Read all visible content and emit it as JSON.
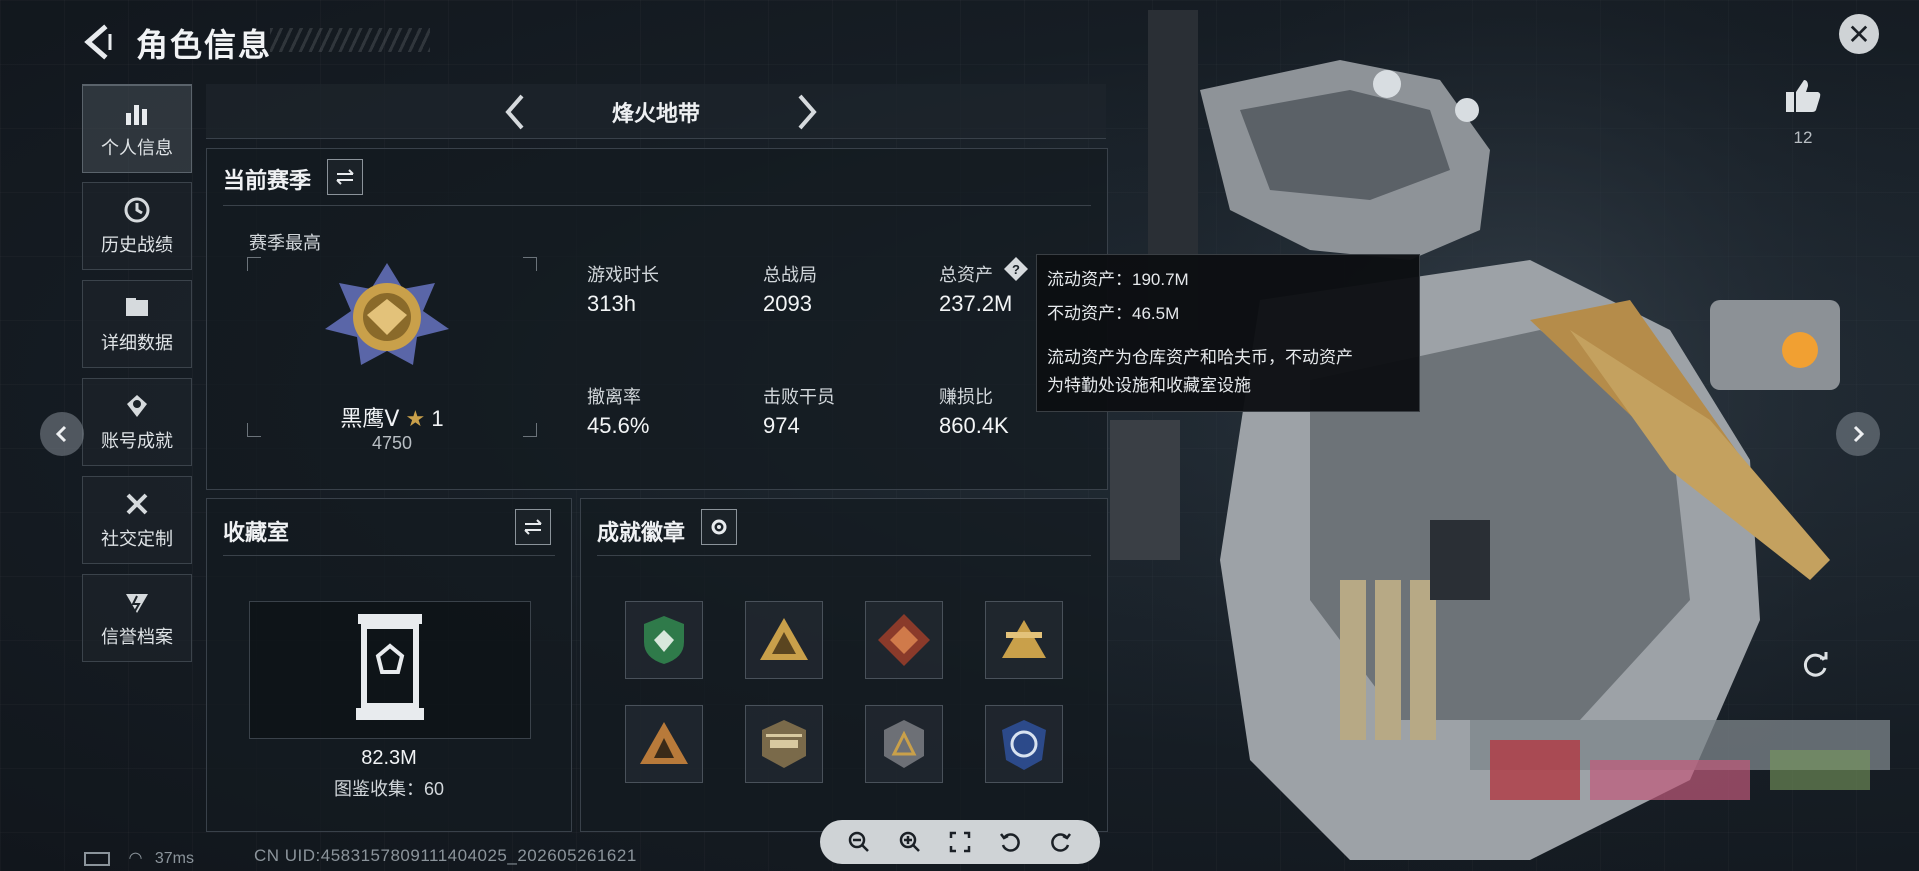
{
  "header": {
    "title": "角色信息",
    "close_icon": "close-icon"
  },
  "nav": [
    {
      "label": "个人信息",
      "icon": "bar-chart-icon",
      "active": true
    },
    {
      "label": "历史战绩",
      "icon": "history-clock-icon",
      "active": false
    },
    {
      "label": "详细数据",
      "icon": "folder-icon",
      "active": false
    },
    {
      "label": "账号成就",
      "icon": "achievement-icon",
      "active": false
    },
    {
      "label": "社交定制",
      "icon": "tools-icon",
      "active": false
    },
    {
      "label": "信誉档案",
      "icon": "credit-shield-icon",
      "active": false
    }
  ],
  "mode": {
    "name": "烽火地带"
  },
  "season": {
    "title": "当前赛季",
    "peak_label": "赛季最高",
    "rank_name": "黑鹰Ⅴ",
    "stars": "1",
    "rank_points": "4750",
    "stats": [
      {
        "label": "游戏时长",
        "value": "313h"
      },
      {
        "label": "总战局",
        "value": "2093"
      },
      {
        "label": "总资产",
        "value": "237.2M"
      },
      {
        "label": "撤离率",
        "value": "45.6%"
      },
      {
        "label": "击败干员",
        "value": "974"
      },
      {
        "label": "赚损比",
        "value": "860.4K"
      }
    ]
  },
  "tooltip": {
    "line1": "流动资产：190.7M",
    "line2": "不动资产：46.5M",
    "line3": "流动资产为仓库资产和哈夫币，不动资产",
    "line4": "为特勤处设施和收藏室设施"
  },
  "collection": {
    "title": "收藏室",
    "value": "82.3M",
    "catalog": "图鉴收集：60"
  },
  "badges": {
    "title": "成就徽章",
    "items": [
      "green-shield-badge",
      "gold-triangle-badge",
      "dragon-diamond-badge",
      "gold-winged-badge",
      "bronze-triangle-badge",
      "helicopter-badge",
      "silver-triangle-badge",
      "blue-emblem-badge"
    ]
  },
  "likes": {
    "count": "12"
  },
  "status": {
    "ping": "37ms",
    "uid": "CN UID:4583157809111404025_202605261621"
  },
  "colors": {
    "accent_gold": "#c9a04a",
    "panel_border": "#39414a",
    "background": "#141a21"
  }
}
